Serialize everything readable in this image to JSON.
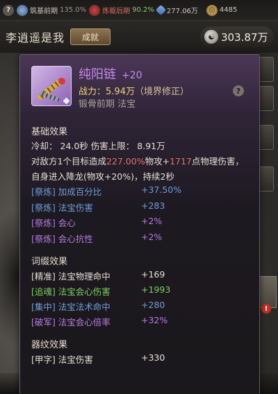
{
  "topbar": {
    "realm1_label": "筑基前期",
    "realm1_pct": "135.0%",
    "realm2_label": "炼躯后期",
    "realm2_pct": "90.2%",
    "stones": "277.06万",
    "coins": "4485"
  },
  "header": {
    "player_name": "李逍遥是我",
    "achievement_label": "成就",
    "power_value": "303.87万"
  },
  "item": {
    "name": "纯阳链",
    "enhance": "+20",
    "power_label": "战力：",
    "power_value": "5.94万",
    "power_note": "（境界修正）",
    "type": "锻骨前期  法宝"
  },
  "basic": {
    "title": "基础效果",
    "cooldown": "冷却：  24.0秒  伤害上限：  8.91万",
    "desc1_a": "对敌方1个目标造成",
    "desc1_pct": "227.00%",
    "desc1_b": "物攻+",
    "desc1_num": "1717",
    "desc1_c": "点物理伤害，",
    "desc2": "自身进入降龙(物攻+20%)，持续2秒",
    "refines": [
      {
        "tag": "[祭炼] 加成百分比",
        "value": "+37.50%"
      },
      {
        "tag": "[祭炼] 法宝伤害",
        "value": "+283"
      },
      {
        "tag": "[祭炼] 会心",
        "value": "+2%"
      },
      {
        "tag": "[祭炼] 会心抗性",
        "value": "+2%"
      }
    ]
  },
  "affix": {
    "title": "词缀效果",
    "rows": [
      {
        "tag": "[精准]  法宝物理命中",
        "value": "+169"
      },
      {
        "tag": "[追魂]  法宝会心伤害",
        "value": "+1993"
      },
      {
        "tag": "[集中]  法宝法术命中",
        "value": "+280"
      },
      {
        "tag": "[破军]  法宝会心倍率",
        "value": "+32%"
      }
    ]
  },
  "pattern": {
    "title": "器纹效果",
    "rows": [
      {
        "tag": "[甲字]  法宝伤害",
        "value": "+330"
      }
    ]
  },
  "icons": {
    "help": "?",
    "badge": "!"
  },
  "colors": {
    "item_name": "#c889f0",
    "power": "#f2d37a",
    "highlight": "#e2726a"
  }
}
